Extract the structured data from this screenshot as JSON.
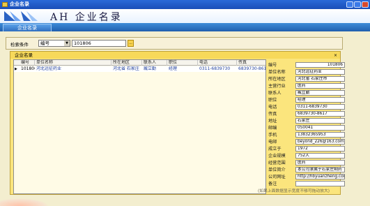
{
  "window": {
    "title": "企业名录"
  },
  "banner": {
    "logo_text": "AH",
    "title": "企业名录"
  },
  "tabs": [
    {
      "label": "企业名录"
    }
  ],
  "search": {
    "label": "检索条件",
    "field": "编号",
    "keyword": "101806",
    "browse": "..."
  },
  "panel": {
    "title": "企业名录",
    "close": "×"
  },
  "grid": {
    "columns": [
      "编号",
      "单位名称",
      "所在地区",
      "联系人",
      "职位",
      "电话",
      "传真"
    ],
    "rows": [
      {
        "编号": "101806",
        "单位名称": "河北远征药业",
        "所在地区": "河北省 石家庄",
        "联系人": "臧立勤",
        "职位": "经理",
        "电话": "0311-6839730",
        "传真": "6839730-8617"
      }
    ]
  },
  "detail": [
    {
      "label": "编号",
      "value": "101806"
    },
    {
      "label": "单位名称",
      "value": "河北远征药业"
    },
    {
      "label": "所在地区",
      "value": "河北省 石家庄市"
    },
    {
      "label": "主营行业",
      "value": "医药"
    },
    {
      "label": "联系人",
      "value": "臧立勤"
    },
    {
      "label": "职位",
      "value": "经理"
    },
    {
      "label": "电话",
      "value": "0311-6839730"
    },
    {
      "label": "传真",
      "value": "6839730-8617"
    },
    {
      "label": "地址",
      "value": "石家庄"
    },
    {
      "label": "邮编",
      "value": "050041"
    },
    {
      "label": "手机",
      "value": "13832365953"
    },
    {
      "label": "电邮",
      "value": "beyond_226@163.com"
    },
    {
      "label": "成立于",
      "value": "1972"
    },
    {
      "label": "企业规模",
      "value": "752人"
    },
    {
      "label": "经营范围",
      "value": "医药"
    },
    {
      "label": "单位简介",
      "value": "本公司隶属于石家庄制药"
    },
    {
      "label": "公司网址",
      "value": "http://hbyuanzheng.com/"
    },
    {
      "label": "备注",
      "value": ""
    }
  ],
  "note": "(如果上面数据显示宽度不够可拖动放大)"
}
